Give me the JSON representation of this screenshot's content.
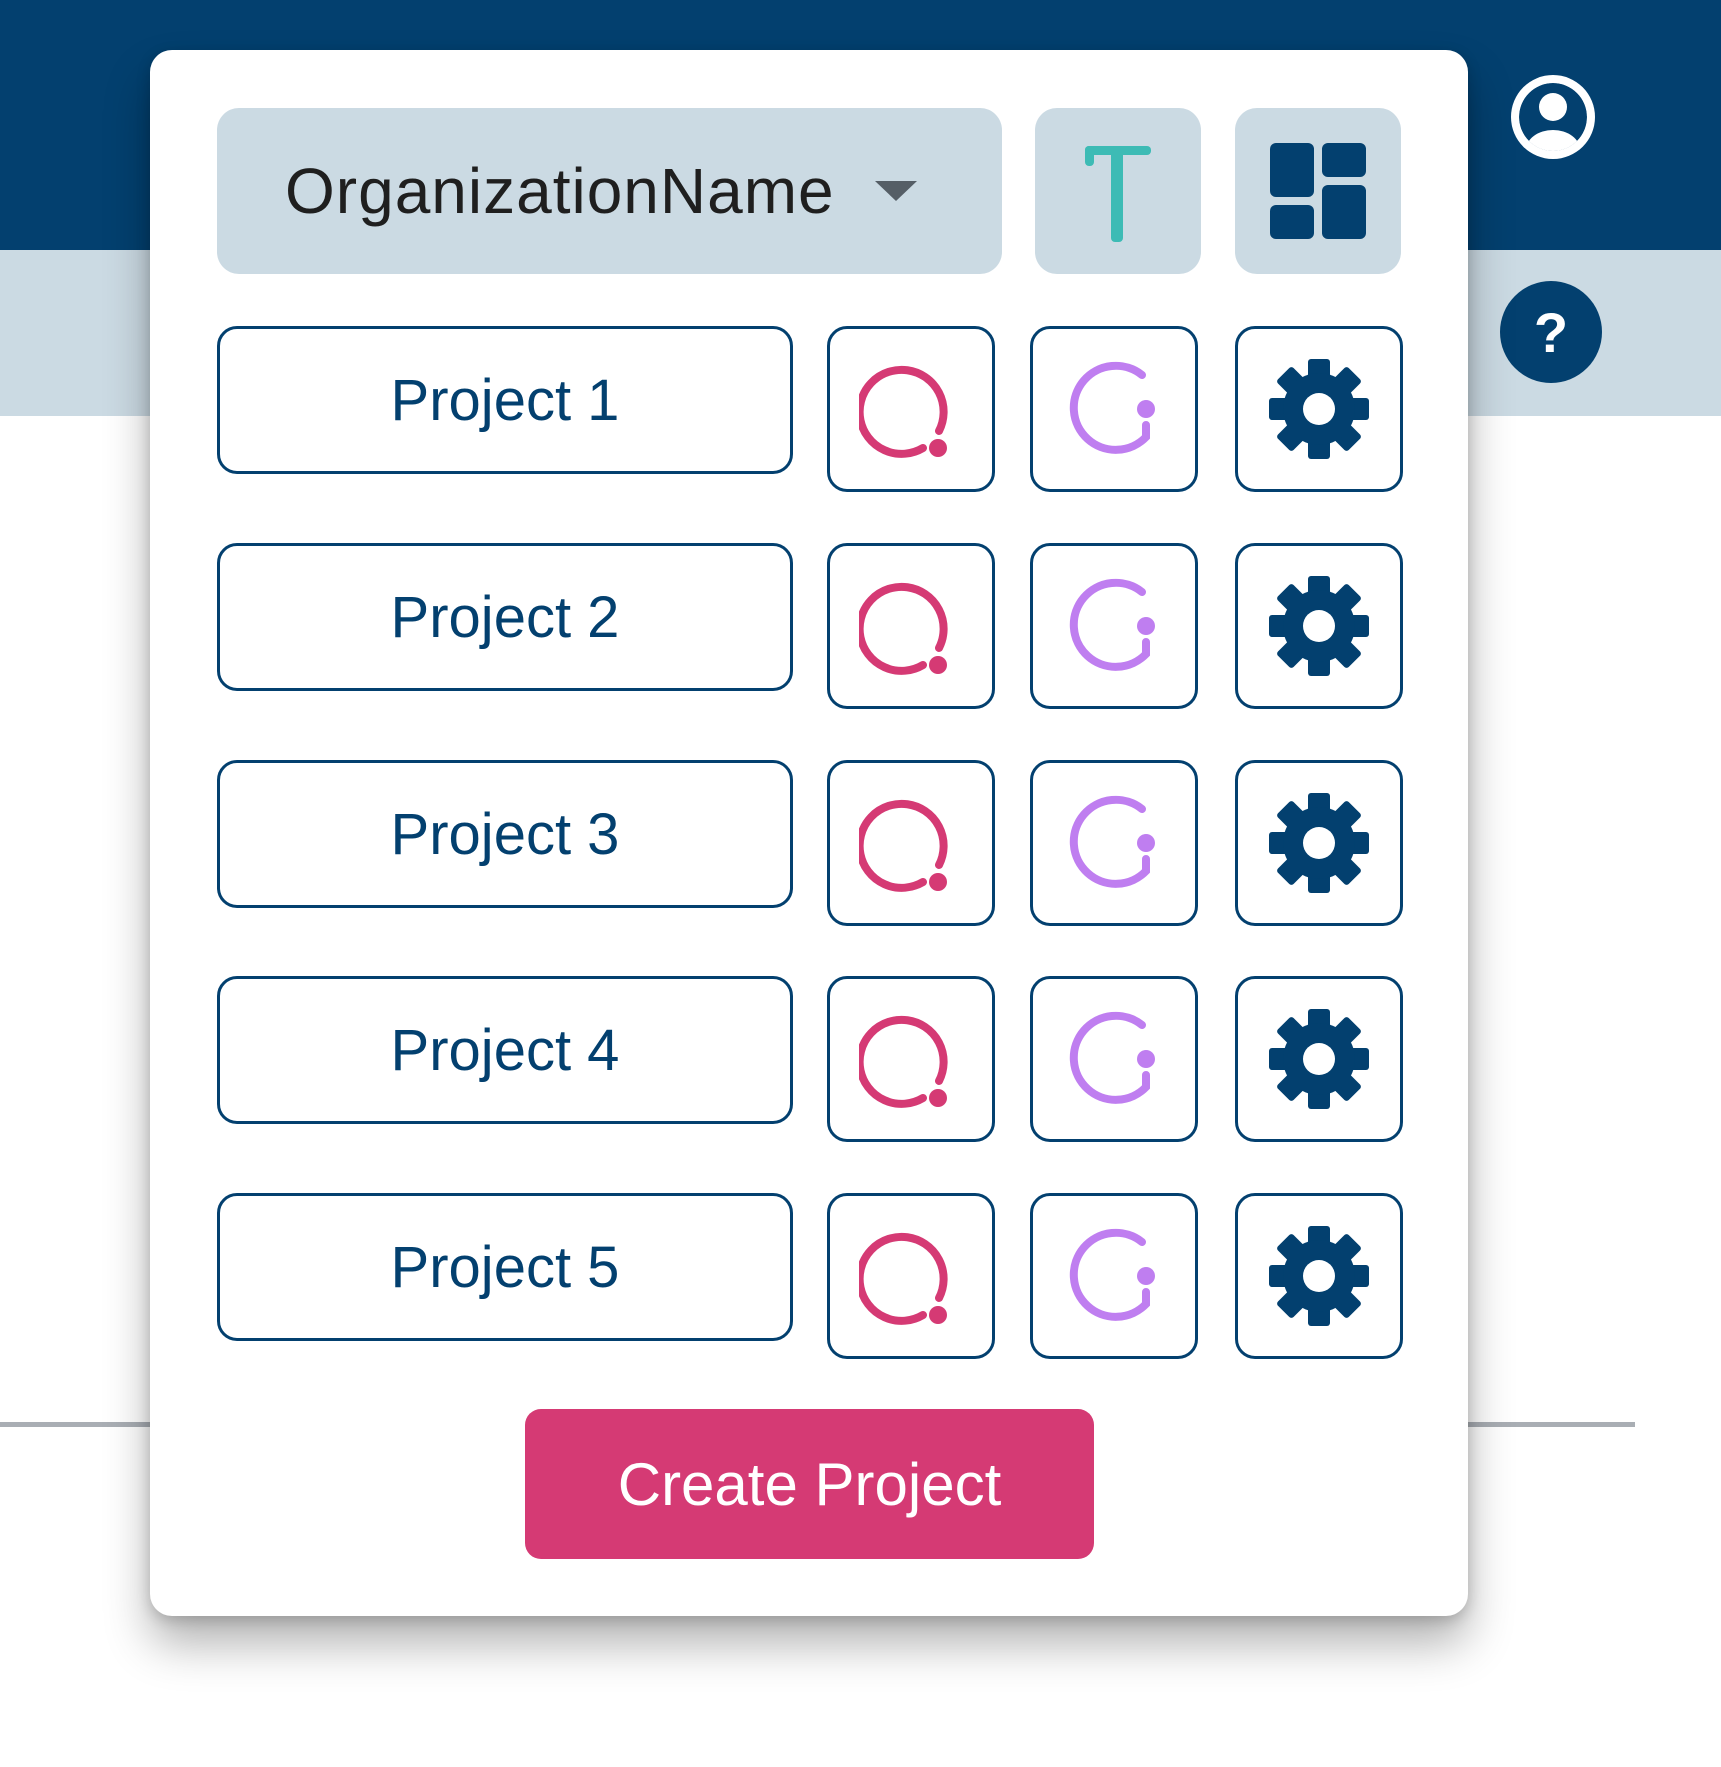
{
  "header": {
    "account_icon": "account-circle-icon",
    "help_label": "?"
  },
  "popover": {
    "organization": {
      "name": "OrganizationName",
      "dropdown_icon": "caret-down-icon"
    },
    "top_buttons": [
      {
        "icon": "t-logo-icon",
        "color": "#3dbbb5"
      },
      {
        "icon": "dashboard-grid-icon",
        "color": "#03406f"
      }
    ],
    "projects": [
      {
        "label": "Project 1"
      },
      {
        "label": "Project 2"
      },
      {
        "label": "Project 3"
      },
      {
        "label": "Project 4"
      },
      {
        "label": "Project 5"
      }
    ],
    "row_icons": [
      {
        "icon": "pink-ring-icon",
        "color": "#d53a74"
      },
      {
        "icon": "purple-g-icon",
        "color": "#bf7ef0"
      },
      {
        "icon": "gear-icon",
        "color": "#03406f"
      }
    ],
    "create_button_label": "Create Project"
  },
  "colors": {
    "header": "#03406f",
    "subheader": "#cbdae3",
    "accent": "#d53a74",
    "border": "#03406f"
  }
}
